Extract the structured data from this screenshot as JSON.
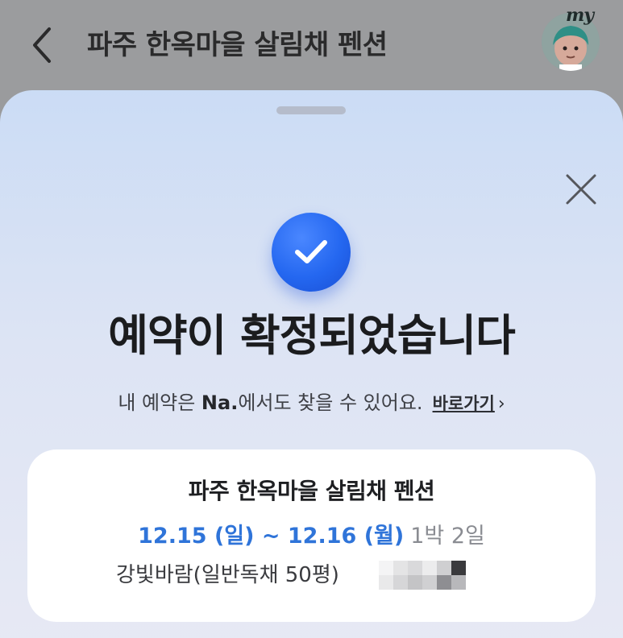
{
  "topbar": {
    "title": "파주 한옥마을 살림채 펜션",
    "avatar_tag": "my"
  },
  "sheet": {
    "headline": "예약이 확정되었습니다",
    "subline_prefix": "내 예약은 ",
    "subline_brand": "Na.",
    "subline_suffix": "에서도 찾을 수 있어요.",
    "shortcut_label": "바로가기",
    "shortcut_chevron": "›"
  },
  "reservation": {
    "property_name": "파주 한옥마을 살림채 펜션",
    "date_range": "12.15 (일) ~ 12.16 (월)",
    "nights": "1박 2일",
    "room": "강빛바람(일반독채 50평)"
  },
  "colors": {
    "accent_blue": "#2f74d9",
    "check_blue": "#2467f0"
  },
  "icons": {
    "back": "chevron-left-icon",
    "close": "close-icon",
    "check": "check-circle-icon"
  }
}
